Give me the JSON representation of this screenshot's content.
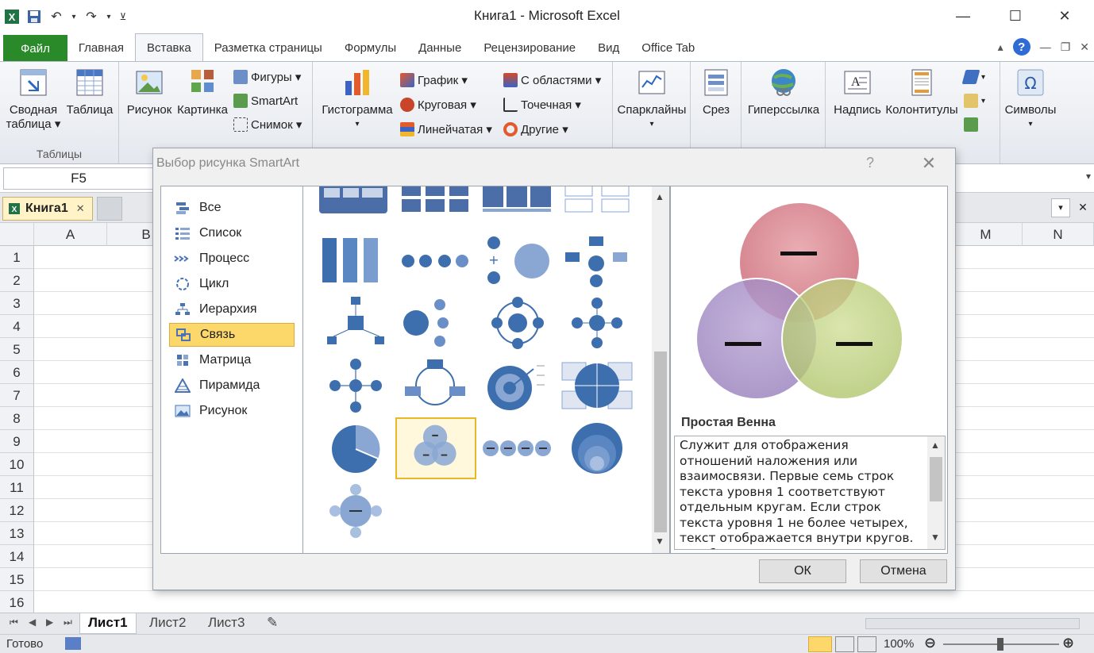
{
  "window": {
    "title": "Книга1  -  Microsoft Excel",
    "minimize": "—",
    "maximize": "☐",
    "close": "✕"
  },
  "ribbon_tabs": [
    "Файл",
    "Главная",
    "Вставка",
    "Разметка страницы",
    "Формулы",
    "Данные",
    "Рецензирование",
    "Вид",
    "Office Tab"
  ],
  "ribbon": {
    "pivot_line1": "Сводная",
    "pivot_line2": "таблица ▾",
    "table": "Таблица",
    "tables_group": "Таблицы",
    "picture": "Рисунок",
    "clipart": "Картинка",
    "shapes": "Фигуры ▾",
    "smartart": "SmartArt",
    "screenshot": "Снимок ▾",
    "histogram": "Гистограмма",
    "graph": "График ▾",
    "pie": "Круговая ▾",
    "barline": "Линейчатая ▾",
    "area": "С областями ▾",
    "scatter": "Точечная ▾",
    "other": "Другие ▾",
    "sparklines": "Спарклайны",
    "slicer": "Срез",
    "hyperlink": "Гиперссылка",
    "textbox": "Надпись",
    "header_footer": "Колонтитулы",
    "symbols": "Символы"
  },
  "formula_bar": {
    "name_box": "F5"
  },
  "workbook_tab": "Книга1",
  "columns": [
    "A",
    "B",
    "M",
    "N"
  ],
  "rows": [
    "1",
    "2",
    "3",
    "4",
    "5",
    "6",
    "7",
    "8",
    "9",
    "10",
    "11",
    "12",
    "13",
    "14",
    "15",
    "16"
  ],
  "sheets": [
    "Лист1",
    "Лист2",
    "Лист3"
  ],
  "status": {
    "ready": "Готово",
    "zoom": "100%"
  },
  "dialog": {
    "title": "Выбор рисунка SmartArt",
    "help": "?",
    "close": "✕",
    "categories": [
      "Все",
      "Список",
      "Процесс",
      "Цикл",
      "Иерархия",
      "Связь",
      "Матрица",
      "Пирамида",
      "Рисунок"
    ],
    "selected_category": "Связь",
    "preview_title": "Простая Венна",
    "description": "Служит для отображения отношений наложения или взаимосвязи. Первые семь строк текста уровня 1 соответствуют отдельным кругам. Если строк текста уровня 1 не более четырех, текст отображается внутри кругов. При большем количестве строк текст уровня",
    "ok": "ОК",
    "cancel": "Отмена"
  },
  "colors": {
    "file_tab": "#2a8a2a",
    "selection": "#fcd86a",
    "smartart_blue": "#3d6fae",
    "venn_red": "#d67f88",
    "venn_purple": "#a38cc2",
    "venn_green": "#b9cf78"
  }
}
